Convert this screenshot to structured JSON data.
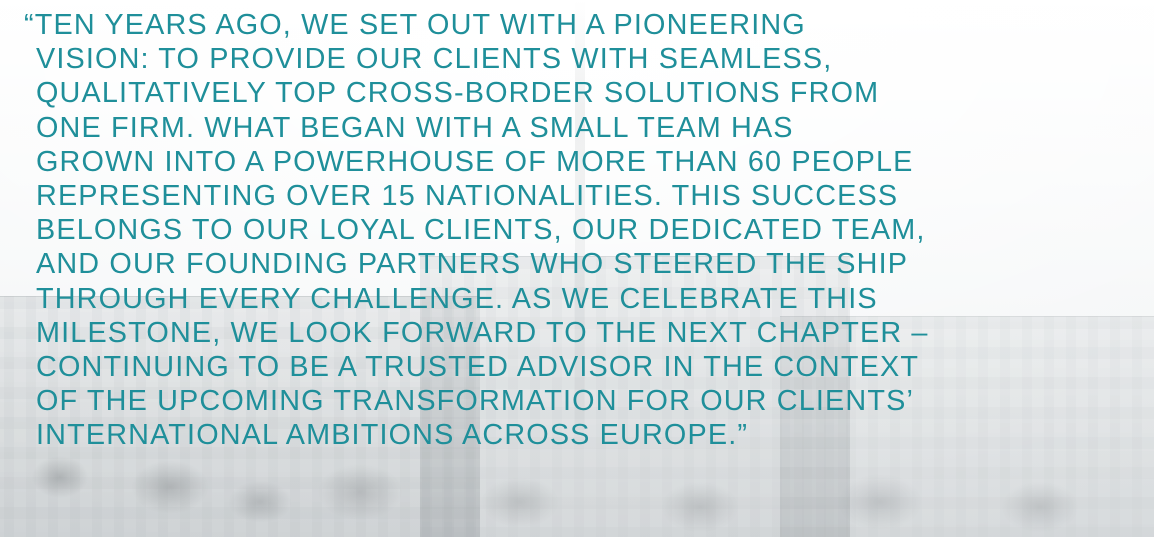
{
  "quote": {
    "lines": [
      "“TEN YEARS AGO, WE SET OUT WITH A PIONEERING",
      "VISION: TO PROVIDE OUR CLIENTS WITH SEAMLESS,",
      "QUALITATIVELY TOP CROSS-BORDER SOLUTIONS FROM",
      "ONE FIRM. WHAT BEGAN WITH A SMALL TEAM HAS",
      "GROWN INTO A POWERHOUSE OF MORE THAN 60 PEOPLE",
      "REPRESENTING OVER 15 NATIONALITIES. THIS SUCCESS",
      "BELONGS TO OUR LOYAL CLIENTS, OUR DEDICATED TEAM,",
      "AND OUR FOUNDING PARTNERS WHO STEERED THE SHIP",
      "THROUGH EVERY CHALLENGE. AS WE CELEBRATE THIS",
      "MILESTONE, WE LOOK FORWARD TO THE NEXT CHAPTER –",
      "CONTINUING TO BE A TRUSTED ADVISOR IN THE CONTEXT",
      "OF THE UPCOMING TRANSFORMATION FOR OUR CLIENTS’",
      "INTERNATIONAL AMBITIONS ACROSS EUROPE.”"
    ],
    "text_color": "#1f8f9a"
  }
}
